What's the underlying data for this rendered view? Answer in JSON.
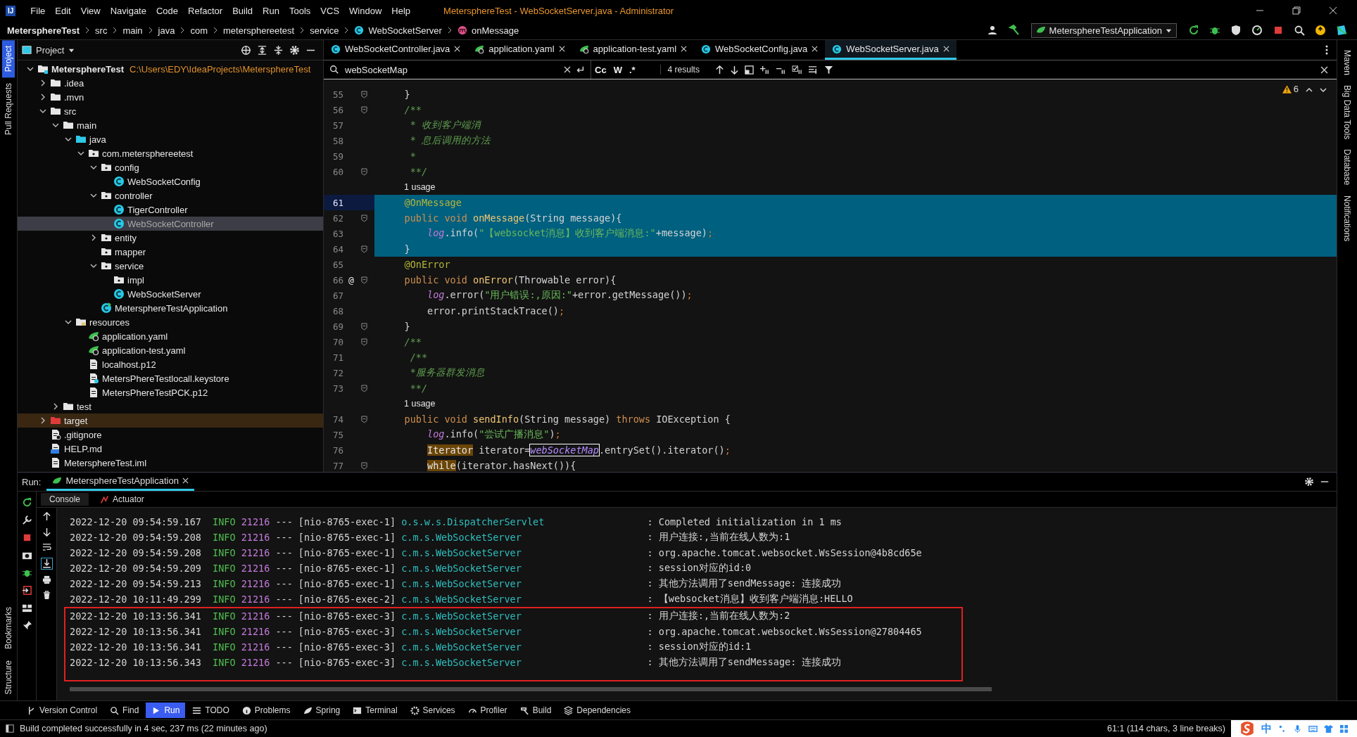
{
  "window": {
    "logo": "IJ",
    "title": "MetersphereTest - WebSocketServer.java - Administrator"
  },
  "menu": [
    "File",
    "Edit",
    "View",
    "Navigate",
    "Code",
    "Refactor",
    "Build",
    "Run",
    "Tools",
    "VCS",
    "Window",
    "Help"
  ],
  "breadcrumbs": [
    {
      "label": "MetersphereTest",
      "kind": "project"
    },
    {
      "label": "src",
      "kind": "dir"
    },
    {
      "label": "main",
      "kind": "dir"
    },
    {
      "label": "java",
      "kind": "dir"
    },
    {
      "label": "com",
      "kind": "dir"
    },
    {
      "label": "metersphereetest",
      "kind": "dir"
    },
    {
      "label": "service",
      "kind": "dir"
    },
    {
      "label": "WebSocketServer",
      "kind": "class"
    },
    {
      "label": "onMessage",
      "kind": "method"
    }
  ],
  "run_config": {
    "label": "MetersphereTestApplication"
  },
  "left_stripe": [
    {
      "label": "Project",
      "selected": true
    },
    {
      "label": "Pull Requests",
      "selected": false
    }
  ],
  "left_stripe_bottom": [
    {
      "label": "Bookmarks"
    },
    {
      "label": "Structure"
    }
  ],
  "right_stripe": [
    {
      "label": "Maven"
    },
    {
      "label": "Big Data Tools"
    },
    {
      "label": "Database"
    },
    {
      "label": "Notifications"
    }
  ],
  "project_panel": {
    "title": "Project",
    "tree": [
      {
        "label": "MetersphereTest",
        "path": "C:\\Users\\EDY\\IdeaProjects\\MetersphereTest",
        "kind": "module",
        "expanded": true,
        "selected": false,
        "children": [
          {
            "label": ".idea",
            "kind": "folder",
            "expanded": false,
            "selected": false
          },
          {
            "label": ".mvn",
            "kind": "folder",
            "expanded": false,
            "selected": false
          },
          {
            "label": "src",
            "kind": "folder",
            "expanded": true,
            "selected": false,
            "children": [
              {
                "label": "main",
                "kind": "folder",
                "expanded": true,
                "selected": false,
                "children": [
                  {
                    "label": "java",
                    "kind": "source",
                    "expanded": true,
                    "selected": false,
                    "children": [
                      {
                        "label": "com.metersphereetest",
                        "kind": "package",
                        "expanded": true,
                        "selected": false,
                        "children": [
                          {
                            "label": "config",
                            "kind": "package",
                            "expanded": true,
                            "selected": false,
                            "children": [
                              {
                                "label": "WebSocketConfig",
                                "kind": "class",
                                "selected": false
                              }
                            ]
                          },
                          {
                            "label": "controller",
                            "kind": "package",
                            "expanded": true,
                            "selected": false,
                            "children": [
                              {
                                "label": "TigerController",
                                "kind": "class",
                                "selected": false
                              },
                              {
                                "label": "WebSocketController",
                                "kind": "class",
                                "selected": true
                              }
                            ]
                          },
                          {
                            "label": "entity",
                            "kind": "package",
                            "expanded": false,
                            "selected": false
                          },
                          {
                            "label": "mapper",
                            "kind": "package",
                            "selected": false
                          },
                          {
                            "label": "service",
                            "kind": "package",
                            "expanded": true,
                            "selected": false,
                            "children": [
                              {
                                "label": "impl",
                                "kind": "package",
                                "selected": false
                              },
                              {
                                "label": "WebSocketServer",
                                "kind": "class",
                                "selected": false
                              }
                            ]
                          },
                          {
                            "label": "MetersphereTestApplication",
                            "kind": "app",
                            "selected": false
                          }
                        ]
                      }
                    ]
                  },
                  {
                    "label": "resources",
                    "kind": "resources",
                    "expanded": true,
                    "selected": false,
                    "children": [
                      {
                        "label": "application.yaml",
                        "kind": "yaml",
                        "selected": false
                      },
                      {
                        "label": "application-test.yaml",
                        "kind": "yaml",
                        "selected": false
                      },
                      {
                        "label": "localhost.p12",
                        "kind": "file",
                        "selected": false
                      },
                      {
                        "label": "MetersPhereTestlocall.keystore",
                        "kind": "keystore",
                        "selected": false
                      },
                      {
                        "label": "MetersPhereTestPCK.p12",
                        "kind": "file",
                        "selected": false
                      }
                    ]
                  }
                ]
              },
              {
                "label": "test",
                "kind": "folder",
                "expanded": false,
                "selected": false
              }
            ]
          },
          {
            "label": "target",
            "kind": "excluded",
            "expanded": false,
            "selected": false
          },
          {
            "label": ".gitignore",
            "kind": "gitignore",
            "selected": false
          },
          {
            "label": "HELP.md",
            "kind": "markdown",
            "selected": false
          },
          {
            "label": "MetersphereTest.iml",
            "kind": "iml",
            "selected": false
          }
        ]
      }
    ]
  },
  "editor": {
    "tabs": [
      {
        "label": "WebSocketController.java",
        "kind": "java",
        "selected": false
      },
      {
        "label": "application.yaml",
        "kind": "yaml",
        "selected": false
      },
      {
        "label": "application-test.yaml",
        "kind": "yaml",
        "selected": false
      },
      {
        "label": "WebSocketConfig.java",
        "kind": "java",
        "selected": false
      },
      {
        "label": "WebSocketServer.java",
        "kind": "java",
        "selected": true
      }
    ],
    "search": {
      "value": "webSocketMap",
      "options": [
        "Cc",
        "W",
        ".*"
      ],
      "results": "4 results"
    },
    "warnings": "6",
    "lines": [
      {
        "kind": "code",
        "number": "55",
        "fold": true,
        "selected": false,
        "caret": false,
        "tokens": [
          {
            "text": "    }",
            "kind": "plain"
          }
        ]
      },
      {
        "kind": "code",
        "number": "56",
        "fold": true,
        "selected": false,
        "caret": false,
        "tokens": [
          {
            "text": "    /**",
            "kind": "comment"
          }
        ]
      },
      {
        "kind": "code",
        "number": "57",
        "fold": false,
        "selected": false,
        "caret": false,
        "tokens": [
          {
            "text": "     * 收到客户端消",
            "kind": "comment"
          }
        ]
      },
      {
        "kind": "code",
        "number": "58",
        "fold": false,
        "selected": false,
        "caret": false,
        "tokens": [
          {
            "text": "     * 息后调用的方法",
            "kind": "comment"
          }
        ]
      },
      {
        "kind": "code",
        "number": "59",
        "fold": false,
        "selected": false,
        "caret": false,
        "tokens": [
          {
            "text": "     *",
            "kind": "comment"
          }
        ]
      },
      {
        "kind": "code",
        "number": "60",
        "fold": true,
        "selected": false,
        "caret": false,
        "tokens": [
          {
            "text": "     **/",
            "kind": "comment"
          }
        ]
      },
      {
        "kind": "inlay",
        "text": "1 usage"
      },
      {
        "kind": "code",
        "number": "61",
        "fold": false,
        "selected": true,
        "caret": true,
        "tokens": [
          {
            "text": "    @OnMessage",
            "kind": "annotation"
          }
        ]
      },
      {
        "kind": "code",
        "number": "62",
        "fold": true,
        "selected": true,
        "caret": false,
        "tokens": [
          {
            "text": "    public void ",
            "kind": "keyword"
          },
          {
            "text": "onMessage",
            "kind": "method"
          },
          {
            "text": "(String message){",
            "kind": "plain"
          }
        ]
      },
      {
        "kind": "code",
        "number": "63",
        "fold": false,
        "selected": true,
        "caret": false,
        "tokens": [
          {
            "text": "        log",
            "kind": "field"
          },
          {
            "text": ".info(",
            "kind": "plain"
          },
          {
            "text": "\"【websocket消息】收到客户端消息:\"",
            "kind": "string"
          },
          {
            "text": "+message)",
            "kind": "plain"
          },
          {
            "text": ";",
            "kind": "punct"
          }
        ]
      },
      {
        "kind": "code",
        "number": "64",
        "fold": true,
        "selected": true,
        "caret": false,
        "tokens": [
          {
            "text": "    }",
            "kind": "plain"
          }
        ]
      },
      {
        "kind": "code",
        "number": "65",
        "fold": false,
        "selected": false,
        "caret": false,
        "tokens": [
          {
            "text": "    @OnError",
            "kind": "annotation"
          }
        ]
      },
      {
        "kind": "code",
        "number": "66",
        "fold": true,
        "mark": "@",
        "selected": false,
        "caret": false,
        "tokens": [
          {
            "text": "    public void ",
            "kind": "keyword"
          },
          {
            "text": "onError",
            "kind": "method"
          },
          {
            "text": "(Throwable error){",
            "kind": "plain"
          }
        ]
      },
      {
        "kind": "code",
        "number": "67",
        "fold": false,
        "selected": false,
        "caret": false,
        "tokens": [
          {
            "text": "        log",
            "kind": "field"
          },
          {
            "text": ".error(",
            "kind": "plain"
          },
          {
            "text": "\"用户错误:,原因:\"",
            "kind": "string"
          },
          {
            "text": "+error.getMessage())",
            "kind": "plain"
          },
          {
            "text": ";",
            "kind": "punct"
          }
        ]
      },
      {
        "kind": "code",
        "number": "68",
        "fold": false,
        "selected": false,
        "caret": false,
        "tokens": [
          {
            "text": "        error.printStackTrace()",
            "kind": "plain"
          },
          {
            "text": ";",
            "kind": "punct"
          }
        ]
      },
      {
        "kind": "code",
        "number": "69",
        "fold": true,
        "selected": false,
        "caret": false,
        "tokens": [
          {
            "text": "    }",
            "kind": "plain"
          }
        ]
      },
      {
        "kind": "code",
        "number": "70",
        "fold": true,
        "selected": false,
        "caret": false,
        "tokens": [
          {
            "text": "    /**",
            "kind": "comment"
          }
        ]
      },
      {
        "kind": "code",
        "number": "71",
        "fold": false,
        "selected": false,
        "caret": false,
        "tokens": [
          {
            "text": "     /**",
            "kind": "comment"
          }
        ]
      },
      {
        "kind": "code",
        "number": "72",
        "fold": false,
        "selected": false,
        "caret": false,
        "tokens": [
          {
            "text": "     *服务器群发消息",
            "kind": "comment"
          }
        ]
      },
      {
        "kind": "code",
        "number": "73",
        "fold": true,
        "selected": false,
        "caret": false,
        "tokens": [
          {
            "text": "     **/",
            "kind": "comment"
          }
        ]
      },
      {
        "kind": "inlay",
        "text": "1 usage"
      },
      {
        "kind": "code",
        "number": "74",
        "fold": true,
        "selected": false,
        "caret": false,
        "tokens": [
          {
            "text": "    public void ",
            "kind": "keyword"
          },
          {
            "text": "sendInfo",
            "kind": "method"
          },
          {
            "text": "(String message) ",
            "kind": "plain"
          },
          {
            "text": "throws",
            "kind": "keyword"
          },
          {
            "text": " IOException {",
            "kind": "plain"
          }
        ]
      },
      {
        "kind": "code",
        "number": "75",
        "fold": false,
        "selected": false,
        "caret": false,
        "tokens": [
          {
            "text": "        log",
            "kind": "field"
          },
          {
            "text": ".info(",
            "kind": "plain"
          },
          {
            "text": "\"尝试广播消息\"",
            "kind": "string"
          },
          {
            "text": ")",
            "kind": "plain"
          },
          {
            "text": ";",
            "kind": "punct"
          }
        ]
      },
      {
        "kind": "code",
        "number": "76",
        "fold": false,
        "selected": false,
        "caret": false,
        "tokens": [
          {
            "text": "        Iterator",
            "kind": "usage"
          },
          {
            "text": " iterator=",
            "kind": "plain"
          },
          {
            "text": "webSocketMap",
            "kind": "match"
          },
          {
            "text": ".entrySet().iterator()",
            "kind": "plain"
          },
          {
            "text": ";",
            "kind": "punct"
          }
        ]
      },
      {
        "kind": "code",
        "number": "77",
        "fold": true,
        "selected": false,
        "caret": false,
        "tokens": [
          {
            "text": "        while",
            "kind": "usage"
          },
          {
            "text": "(iterator.hasNext()){",
            "kind": "plain"
          }
        ]
      }
    ]
  },
  "run_panel": {
    "label": "Run:",
    "tabs": [
      {
        "label": "MetersphereTestApplication",
        "selected": true
      }
    ],
    "subtabs": [
      {
        "label": "Console",
        "selected": true
      },
      {
        "label": "Actuator",
        "selected": false
      }
    ],
    "console": [
      {
        "time": "2022-12-20 09:54:59.167",
        "level": "INFO",
        "pid": "21216",
        "sep": "---",
        "thread": "[nio-8765-exec-1]",
        "logger": "o.s.w.s.DispatcherServlet",
        "message": ": Completed initialization in 1 ms",
        "boxed": false
      },
      {
        "time": "2022-12-20 09:54:59.208",
        "level": "INFO",
        "pid": "21216",
        "sep": "---",
        "thread": "[nio-8765-exec-1]",
        "logger": "c.m.s.WebSocketServer",
        "message": ": 用户连接:,当前在线人数为:1",
        "boxed": false
      },
      {
        "time": "2022-12-20 09:54:59.208",
        "level": "INFO",
        "pid": "21216",
        "sep": "---",
        "thread": "[nio-8765-exec-1]",
        "logger": "c.m.s.WebSocketServer",
        "message": ": org.apache.tomcat.websocket.WsSession@4b8cd65e",
        "boxed": false
      },
      {
        "time": "2022-12-20 09:54:59.209",
        "level": "INFO",
        "pid": "21216",
        "sep": "---",
        "thread": "[nio-8765-exec-1]",
        "logger": "c.m.s.WebSocketServer",
        "message": ": session对应的id:0",
        "boxed": false
      },
      {
        "time": "2022-12-20 09:54:59.213",
        "level": "INFO",
        "pid": "21216",
        "sep": "---",
        "thread": "[nio-8765-exec-1]",
        "logger": "c.m.s.WebSocketServer",
        "message": ": 其他方法调用了sendMessage: 连接成功",
        "boxed": false
      },
      {
        "time": "2022-12-20 10:11:49.299",
        "level": "INFO",
        "pid": "21216",
        "sep": "---",
        "thread": "[nio-8765-exec-2]",
        "logger": "c.m.s.WebSocketServer",
        "message": ": 【websocket消息】收到客户端消息:HELLO",
        "boxed": false
      },
      {
        "time": "2022-12-20 10:13:56.341",
        "level": "INFO",
        "pid": "21216",
        "sep": "---",
        "thread": "[nio-8765-exec-3]",
        "logger": "c.m.s.WebSocketServer",
        "message": ": 用户连接:,当前在线人数为:2",
        "boxed": true
      },
      {
        "time": "2022-12-20 10:13:56.341",
        "level": "INFO",
        "pid": "21216",
        "sep": "---",
        "thread": "[nio-8765-exec-3]",
        "logger": "c.m.s.WebSocketServer",
        "message": ": org.apache.tomcat.websocket.WsSession@27804465",
        "boxed": true
      },
      {
        "time": "2022-12-20 10:13:56.341",
        "level": "INFO",
        "pid": "21216",
        "sep": "---",
        "thread": "[nio-8765-exec-3]",
        "logger": "c.m.s.WebSocketServer",
        "message": ": session对应的id:1",
        "boxed": true
      },
      {
        "time": "2022-12-20 10:13:56.343",
        "level": "INFO",
        "pid": "21216",
        "sep": "---",
        "thread": "[nio-8765-exec-3]",
        "logger": "c.m.s.WebSocketServer",
        "message": ": 其他方法调用了sendMessage: 连接成功",
        "boxed": true
      }
    ]
  },
  "tool_strip": [
    {
      "label": "Version Control",
      "selected": false
    },
    {
      "label": "Find",
      "selected": false
    },
    {
      "label": "Run",
      "selected": true
    },
    {
      "label": "TODO",
      "selected": false
    },
    {
      "label": "Problems",
      "selected": false
    },
    {
      "label": "Spring",
      "selected": false
    },
    {
      "label": "Terminal",
      "selected": false
    },
    {
      "label": "Services",
      "selected": false
    },
    {
      "label": "Profiler",
      "selected": false
    },
    {
      "label": "Build",
      "selected": false
    },
    {
      "label": "Dependencies",
      "selected": false
    }
  ],
  "status_bar": {
    "message": "Build completed successfully in 4 sec, 237 ms (22 minutes ago)",
    "position": "61:1 (114 chars, 3 line breaks)",
    "ime": "中"
  }
}
